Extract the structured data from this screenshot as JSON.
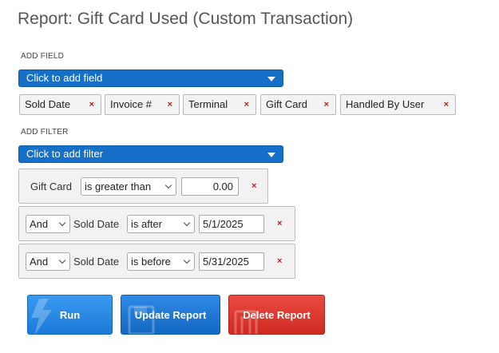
{
  "page": {
    "title": "Report: Gift Card Used (Custom Transaction)"
  },
  "add_field": {
    "label": "ADD FIELD",
    "dropdown_text": "Click to add field",
    "chips": [
      {
        "label": "Sold Date"
      },
      {
        "label": "Invoice #"
      },
      {
        "label": "Terminal"
      },
      {
        "label": "Gift Card"
      },
      {
        "label": "Handled By User"
      }
    ],
    "remove_symbol": "×"
  },
  "add_filter": {
    "label": "ADD FILTER",
    "dropdown_text": "Click to add filter"
  },
  "filters": [
    {
      "field": "Gift Card",
      "operator": "is greater than",
      "value": "0.00",
      "remove": "×"
    },
    {
      "conjunction": "And",
      "field": "Sold Date",
      "operator": "is after",
      "value": "5/1/2025",
      "remove": "×"
    },
    {
      "conjunction": "And",
      "field": "Sold Date",
      "operator": "is before",
      "value": "5/31/2025",
      "remove": "×"
    }
  ],
  "actions": {
    "run": "Run",
    "update": "Update Report",
    "delete": "Delete Report"
  },
  "colors": {
    "primary": "#1670c9",
    "danger": "#cf2a22",
    "remove_x": "#b0211c"
  }
}
